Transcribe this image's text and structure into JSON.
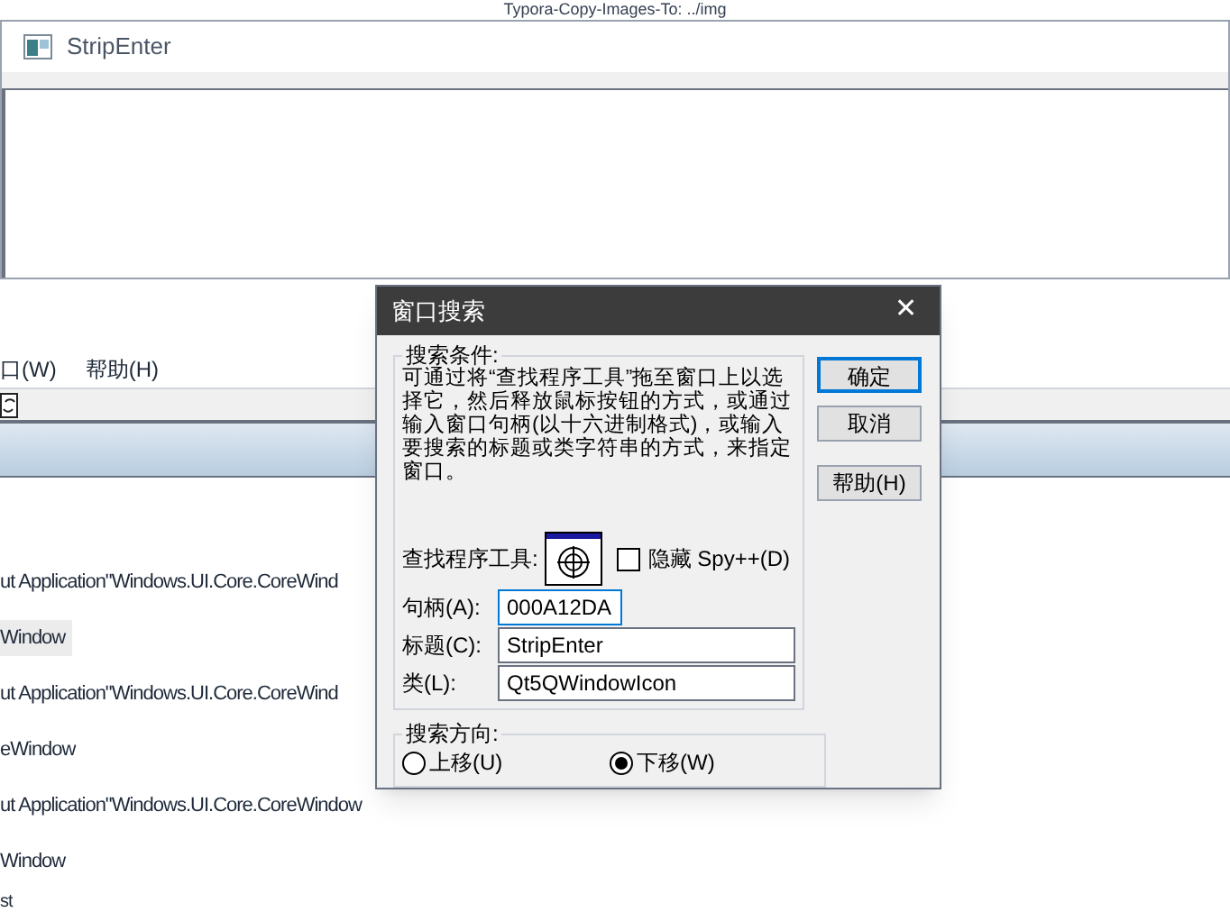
{
  "background_text": "Typora-Copy-Images-To: ../img",
  "front_window": {
    "title": "StripEnter"
  },
  "back_window": {
    "menu": [
      "口(W)",
      "帮助(H)"
    ],
    "lines": [
      {
        "text": "ut Application\"Windows.UI.Core.CoreWind",
        "selected": false
      },
      {
        "text": "Window",
        "selected": true
      },
      {
        "text": "ut Application\"Windows.UI.Core.CoreWind",
        "selected": false
      },
      {
        "text": "eWindow",
        "selected": false
      },
      {
        "text": "ut Application\"Windows.UI.Core.CoreWindow",
        "selected": false
      },
      {
        "text": "Window",
        "selected": false
      },
      {
        "text": "st",
        "selected": false
      }
    ]
  },
  "dialog": {
    "title": "窗口搜索",
    "close": "✕",
    "criteria": {
      "legend": "搜索条件:",
      "description": "可通过将“查找程序工具”拖至窗口上以选择它，然后释放鼠标按钮的方式，或通过输入窗口句柄(以十六进制格式)，或输入要搜索的标题或类字符串的方式，来指定窗口。",
      "finder_label": "查找程序工具:",
      "hide": {
        "label": "隐藏 Spy++(D)",
        "checked": false
      },
      "fields": [
        {
          "label": "句柄(A):",
          "value": "000A12DA",
          "focused": true
        },
        {
          "label": "标题(C):",
          "value": "StripEnter",
          "focused": false
        },
        {
          "label": "类(L):",
          "value": "Qt5QWindowIcon",
          "focused": false
        }
      ]
    },
    "direction": {
      "legend": "搜索方向:",
      "options": [
        {
          "label": "上移(U)",
          "selected": false
        },
        {
          "label": "下移(W)",
          "selected": true
        }
      ]
    },
    "buttons": [
      {
        "label": "确定",
        "default": true
      },
      {
        "label": "取消",
        "default": false
      },
      {
        "label": "帮助(H)",
        "default": false
      }
    ]
  }
}
